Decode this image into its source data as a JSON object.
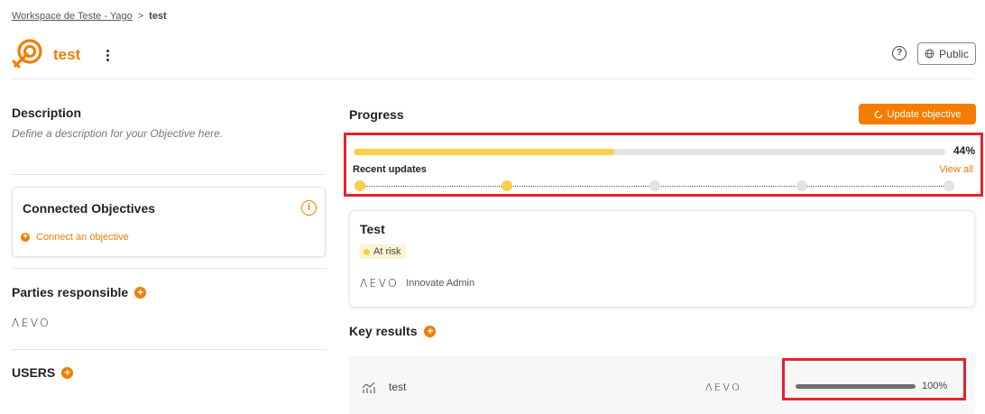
{
  "breadcrumb": {
    "workspace": "Workspace de Teste - Yago",
    "separator": ">",
    "current": "test"
  },
  "header": {
    "title": "test",
    "logo_icon": "target-icon",
    "menu_icon": "kebab-menu-icon",
    "help_icon_label": "?",
    "visibility_label": "Public",
    "visibility_icon": "globe-icon"
  },
  "left": {
    "description_title": "Description",
    "description_placeholder": "Define a description for your Objective here.",
    "connected_title": "Connected Objectives",
    "connected_info_icon": "i",
    "connect_link": "Connect an objective",
    "parties_title": "Parties responsible",
    "parties_logo": "ΛEVO",
    "users_title": "USERS"
  },
  "progress": {
    "title": "Progress",
    "update_button": "Update objective",
    "value": 44,
    "value_label": "44%",
    "recent_updates_label": "Recent updates",
    "view_all": "View all",
    "timeline": [
      true,
      true,
      false,
      false,
      false
    ]
  },
  "objective_card": {
    "title": "Test",
    "status": "At risk",
    "owner_logo": "ΛEVO",
    "owner_name": "Innovate Admin"
  },
  "key_results": {
    "title": "Key results",
    "items": [
      {
        "icon": "chart-icon",
        "name": "test",
        "owner_logo": "ΛEVO",
        "progress": 100,
        "progress_label": "100%"
      }
    ]
  },
  "colors": {
    "accent": "#f07d00",
    "progress_fill": "#f8cf4a",
    "highlight_border": "#e1232e",
    "kr_fill": "#6f6f6f"
  }
}
